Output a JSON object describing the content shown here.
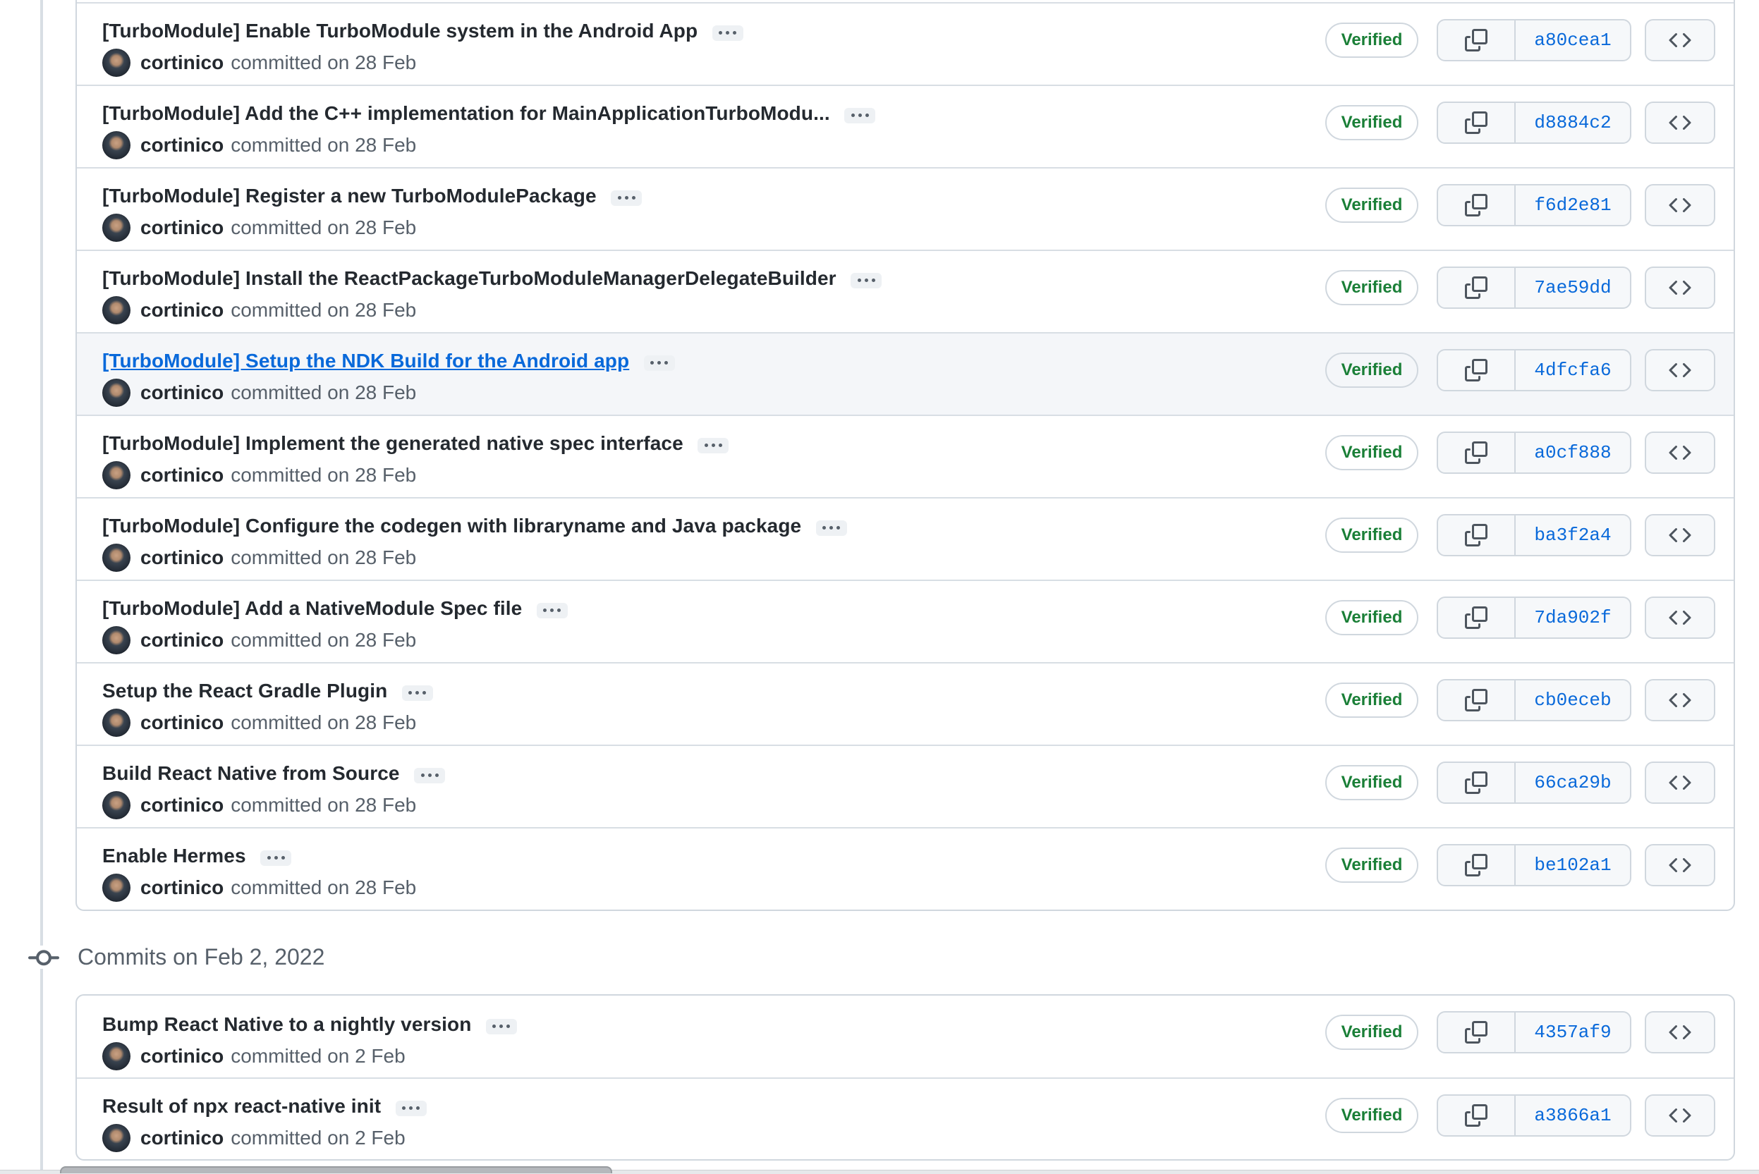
{
  "page": {
    "kind": "github-commit-list",
    "section2_header": "Commits on Feb 2, 2022"
  },
  "labels": {
    "verified_badge": "Verified",
    "author": "cortinico"
  },
  "icons": {
    "commit_dot": "git-commit-icon",
    "copy": "copy-icon",
    "code": "code-icon",
    "expander": "ellipsis-icon"
  },
  "colors": {
    "title": "#24292f",
    "link_blue": "#0969da",
    "muted_text": "#57606a",
    "verified_green": "#1a7f37",
    "border": "#d0d7de",
    "row_divider": "#d8dee4",
    "button_bg": "#f6f8fa",
    "highlight_row_bg": "#f4f6f9"
  },
  "groups": [
    {
      "header": null,
      "commits": [
        {
          "title": "[TurboModule] Enable TurboModule system in the Android App",
          "author": "cortinico",
          "meta": "committed on 28 Feb",
          "badge": "Verified",
          "sha": "a80cea1",
          "link": false,
          "highlighted": false,
          "expander": false
        },
        {
          "title": "[TurboModule] Add the C++ implementation for MainApplicationTurboModu...",
          "author": "cortinico",
          "meta": "committed on 28 Feb",
          "badge": "Verified",
          "sha": "d8884c2",
          "link": false,
          "highlighted": false,
          "expander": true
        },
        {
          "title": "[TurboModule] Register a new TurboModulePackage",
          "author": "cortinico",
          "meta": "committed on 28 Feb",
          "badge": "Verified",
          "sha": "f6d2e81",
          "link": false,
          "highlighted": false,
          "expander": false
        },
        {
          "title": "[TurboModule] Install the ReactPackageTurboModuleManagerDelegateBuilder",
          "author": "cortinico",
          "meta": "committed on 28 Feb",
          "badge": "Verified",
          "sha": "7ae59dd",
          "link": false,
          "highlighted": false,
          "expander": false
        },
        {
          "title": "[TurboModule] Setup the NDK Build for the Android app",
          "author": "cortinico",
          "meta": "committed on 28 Feb",
          "badge": "Verified",
          "sha": "4dfcfa6",
          "link": true,
          "highlighted": true,
          "expander": false
        },
        {
          "title": "[TurboModule] Implement the generated native spec interface",
          "author": "cortinico",
          "meta": "committed on 28 Feb",
          "badge": "Verified",
          "sha": "a0cf888",
          "link": false,
          "highlighted": false,
          "expander": false
        },
        {
          "title": "[TurboModule] Configure the codegen with libraryname and Java package",
          "author": "cortinico",
          "meta": "committed on 28 Feb",
          "badge": "Verified",
          "sha": "ba3f2a4",
          "link": false,
          "highlighted": false,
          "expander": false
        },
        {
          "title": "[TurboModule] Add a NativeModule Spec file",
          "author": "cortinico",
          "meta": "committed on 28 Feb",
          "badge": "Verified",
          "sha": "7da902f",
          "link": false,
          "highlighted": false,
          "expander": false
        },
        {
          "title": "Setup the React Gradle Plugin",
          "author": "cortinico",
          "meta": "committed on 28 Feb",
          "badge": "Verified",
          "sha": "cb0eceb",
          "link": false,
          "highlighted": false,
          "expander": false
        },
        {
          "title": "Build React Native from Source",
          "author": "cortinico",
          "meta": "committed on 28 Feb",
          "badge": "Verified",
          "sha": "66ca29b",
          "link": false,
          "highlighted": false,
          "expander": false
        },
        {
          "title": "Enable Hermes",
          "author": "cortinico",
          "meta": "committed on 28 Feb",
          "badge": "Verified",
          "sha": "be102a1",
          "link": false,
          "highlighted": false,
          "expander": false
        }
      ]
    },
    {
      "header": "Commits on Feb 2, 2022",
      "commits": [
        {
          "title": "Bump React Native to a nightly version",
          "author": "cortinico",
          "meta": "committed on 2 Feb",
          "badge": "Verified",
          "sha": "4357af9",
          "link": false,
          "highlighted": false,
          "expander": false
        },
        {
          "title": "Result of npx react-native init",
          "author": "cortinico",
          "meta": "committed on 2 Feb",
          "badge": "Verified",
          "sha": "a3866a1",
          "link": false,
          "highlighted": false,
          "expander": false
        }
      ]
    }
  ]
}
